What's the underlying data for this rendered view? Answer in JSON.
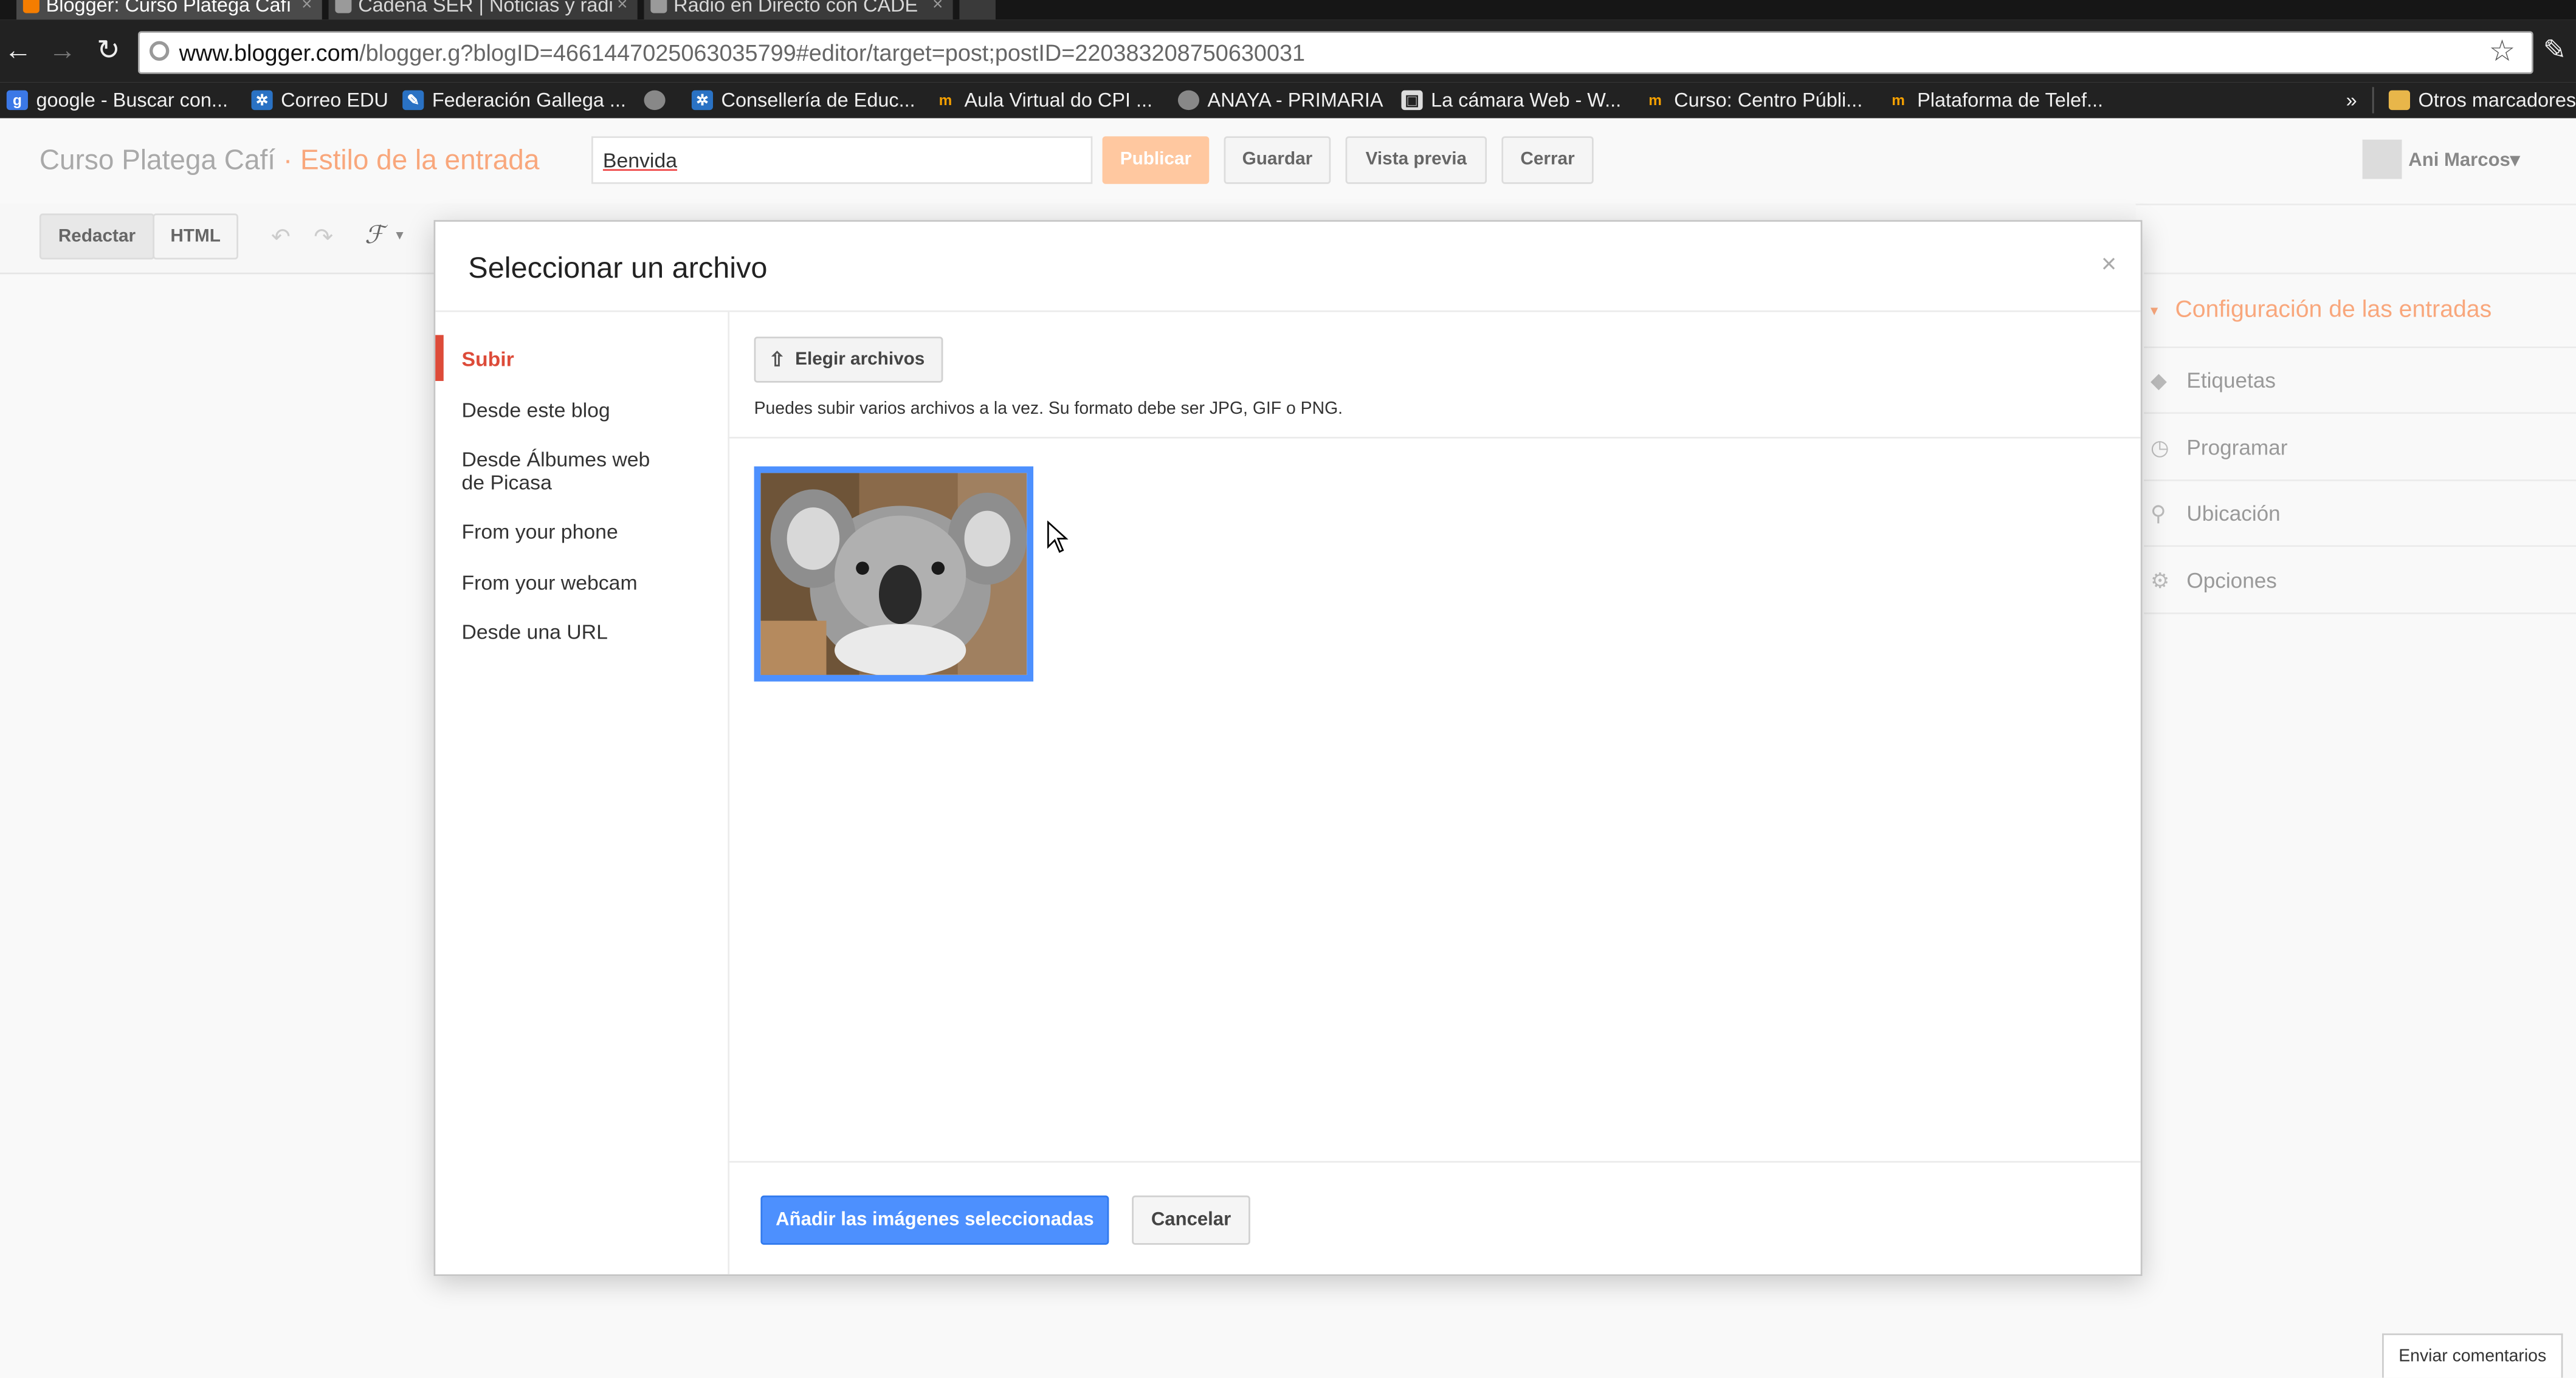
{
  "browser": {
    "tabs": [
      {
        "title": "Blogger: Curso Platega Cafí",
        "close": "×"
      },
      {
        "title": "Cadena SER | Noticias y radi",
        "close": "×"
      },
      {
        "title": "Radio en Directo con CADE",
        "close": "×"
      }
    ],
    "url_domain": "www.blogger.com",
    "url_path": "/blogger.g?blogID=4661447025063035799#editor/target=post;postID=220383208750630031",
    "bookmarks": [
      "google - Buscar con...",
      "Correo EDU",
      "Federación Gallega ...",
      "Consellería de Educ...",
      "Aula Virtual do CPI ...",
      "ANAYA - PRIMARIA",
      "La cámara Web - W...",
      "Curso: Centro Públi...",
      "Plataforma de Telef..."
    ],
    "bookmarks_overflow": "»",
    "other_bookmarks": "Otros marcadores"
  },
  "blogger": {
    "blog_name": "Curso Platega Cafí",
    "separator": "·",
    "section_title": "Estilo de la entrada",
    "post_title_value": "Benvida",
    "publish": "Publicar",
    "save": "Guardar",
    "preview": "Vista previa",
    "close": "Cerrar",
    "user_name": "Ani Marcos",
    "user_menu_arrow": "▾"
  },
  "editor": {
    "compose": "Redactar",
    "html": "HTML"
  },
  "settings_panel": {
    "heading": "Configuración de las entradas",
    "items": [
      "Etiquetas",
      "Programar",
      "Ubicación",
      "Opciones"
    ]
  },
  "modal": {
    "title": "Seleccionar un archivo",
    "close": "×",
    "sidebar": [
      "Subir",
      "Desde este blog",
      "Desde Álbumes web de Picasa",
      "From your phone",
      "From your webcam",
      "Desde una URL"
    ],
    "choose_files": "Elegir archivos",
    "upload_hint": "Puedes subir varios archivos a la vez. Su formato debe ser JPG, GIF o PNG.",
    "add_selected": "Añadir las imágenes seleccionadas",
    "cancel": "Cancelar"
  },
  "feedback": "Enviar comentarios",
  "colors": {
    "accent_orange": "#f9a77c",
    "publish_bg": "#ffc8a0",
    "selected_red": "#dd4b39",
    "primary_blue": "#4d90fe"
  }
}
